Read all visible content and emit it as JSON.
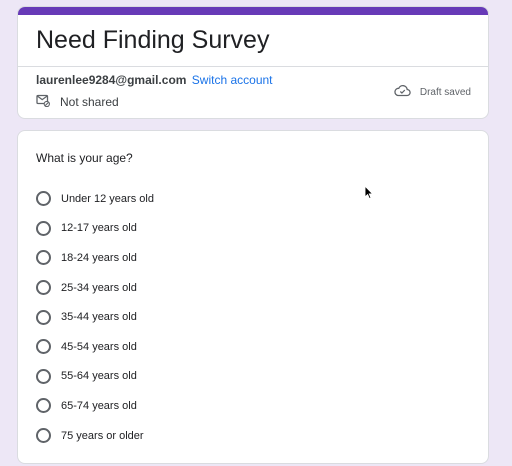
{
  "form": {
    "title": "Need Finding Survey",
    "accent_color": "#673ab7",
    "background_color": "#ede7f6"
  },
  "account": {
    "email": "laurenlee9284@gmail.com",
    "switch_label": "Switch account",
    "shared_status": "Not shared",
    "shared_icon": "mail-lock-icon",
    "draft_status": "Draft saved",
    "draft_icon": "cloud-done-icon"
  },
  "question": {
    "title": "What is your age?",
    "options": [
      "Under 12 years old",
      "12-17 years old",
      "18-24 years old",
      "25-34 years old",
      "35-44 years old",
      "45-54 years old",
      "55-64 years old",
      "65-74 years old",
      "75 years or older"
    ],
    "selected": null
  }
}
